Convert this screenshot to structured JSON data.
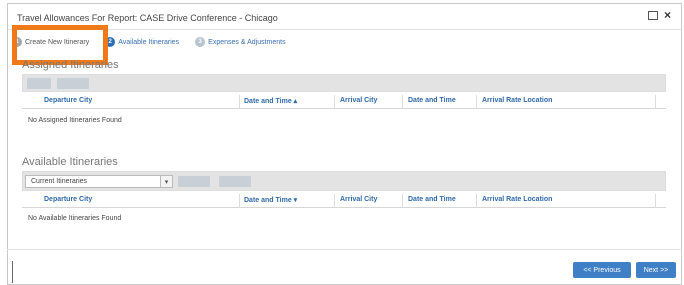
{
  "dialog": {
    "title": "Travel Allowances For Report: CASE Drive Conference - Chicago",
    "close_glyph": "×"
  },
  "steps": [
    {
      "number": "1",
      "label": "Create New Itinerary"
    },
    {
      "number": "2",
      "label": "Available Itineraries"
    },
    {
      "number": "3",
      "label": "Expenses & Adjustments"
    }
  ],
  "assigned": {
    "title": "Assigned Itineraries",
    "columns": [
      "Departure City",
      "Date and Time ▴",
      "Arrival City",
      "Date and Time",
      "Arrival Rate Location"
    ],
    "empty_text": "No Assigned Itineraries Found"
  },
  "available": {
    "title": "Available Itineraries",
    "filter_value": "Current Itineraries",
    "columns": [
      "Departure City",
      "Date and Time ▾",
      "Arrival City",
      "Date and Time",
      "Arrival Rate Location"
    ],
    "empty_text": "No Available Itineraries Found"
  },
  "footer": {
    "previous_label": "<< Previous",
    "next_label": "Next >>"
  },
  "colors": {
    "highlight": "#f07a1a",
    "accent": "#2c6fb7",
    "header_text": "#2f6aa8"
  }
}
